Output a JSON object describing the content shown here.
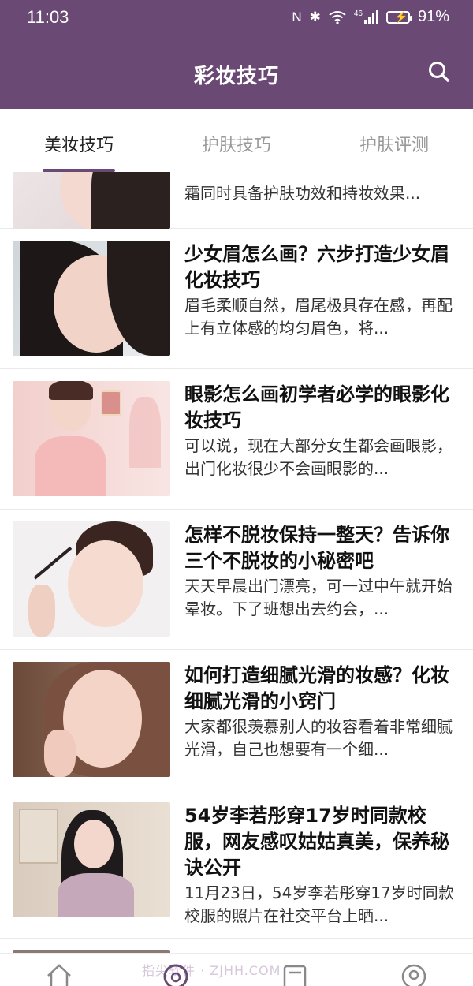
{
  "status_bar": {
    "time": "11:03",
    "nfc": "N",
    "bluetooth": "✱",
    "network": "46",
    "battery_pct": "91%"
  },
  "header": {
    "title": "彩妆技巧"
  },
  "tabs": [
    {
      "label": "美妆技巧",
      "active": true
    },
    {
      "label": "护肤技巧",
      "active": false
    },
    {
      "label": "护肤评测",
      "active": false
    }
  ],
  "articles": [
    {
      "title": "",
      "desc": "霜同时具备护肤功效和持妆效果..."
    },
    {
      "title": "少女眉怎么画？六步打造少女眉化妆技巧",
      "desc": "眉毛柔顺自然，眉尾极具存在感，再配上有立体感的均匀眉色，将..."
    },
    {
      "title": "眼影怎么画初学者必学的眼影化妆技巧",
      "desc": "可以说，现在大部分女生都会画眼影，出门化妆很少不会画眼影的..."
    },
    {
      "title": "怎样不脱妆保持一整天？告诉你三个不脱妆的小秘密吧",
      "desc": "天天早晨出门漂亮，可一过中午就开始晕妆。下了班想出去约会，..."
    },
    {
      "title": "如何打造细腻光滑的妆感？化妆细腻光滑的小窍门",
      "desc": "大家都很羡慕别人的妆容看着非常细腻光滑，自己也想要有一个细..."
    },
    {
      "title": "54岁李若彤穿17岁时同款校服，网友感叹姑姑真美，保养秘诀公开",
      "desc": "11月23日，54岁李若彤穿17岁时同款校服的照片在社交平台上晒..."
    }
  ],
  "bottom_nav": {
    "watermark": "指尖软件 · ZJHH.COM",
    "items": [
      "home-icon",
      "idea-icon",
      "article-icon",
      "profile-icon"
    ]
  },
  "colors": {
    "brand": "#6a4a74",
    "divider": "#e9e9e9"
  }
}
